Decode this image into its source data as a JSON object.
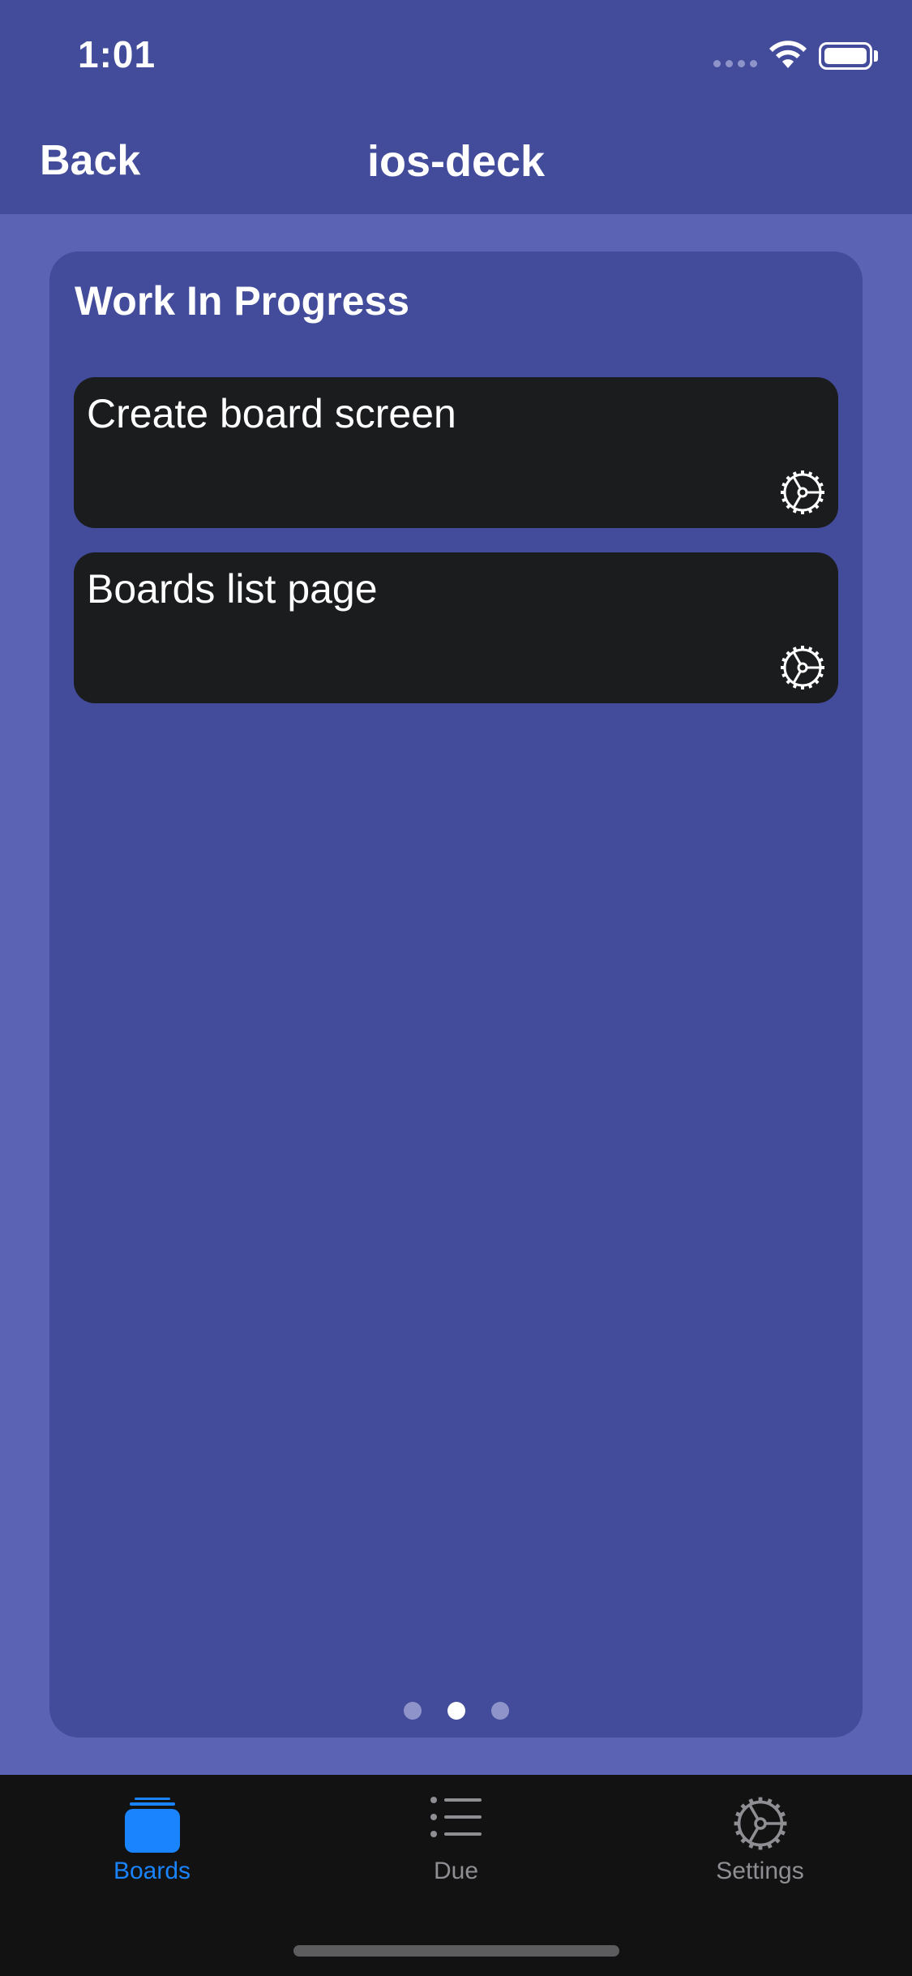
{
  "status_bar": {
    "time": "1:01"
  },
  "nav": {
    "back_label": "Back",
    "title": "ios-deck"
  },
  "stack": {
    "title": "Work In Progress",
    "cards": [
      {
        "title": "Create board screen",
        "icon": "settings-gear-icon"
      },
      {
        "title": "Boards list page",
        "icon": "settings-gear-icon"
      }
    ],
    "page_indicator": {
      "count": 3,
      "current": 2
    }
  },
  "tabbar": {
    "tabs": [
      {
        "label": "Boards",
        "icon": "boards-stack-icon",
        "selected": true
      },
      {
        "label": "Due",
        "icon": "list-icon",
        "selected": false
      },
      {
        "label": "Settings",
        "icon": "gear-icon",
        "selected": false
      }
    ]
  },
  "colors": {
    "nav_background": "#434c9b",
    "page_background": "#5b63b5",
    "card_background": "#1b1c1e",
    "tab_selected": "#1a84ff",
    "tab_unselected": "#8e8e93"
  }
}
